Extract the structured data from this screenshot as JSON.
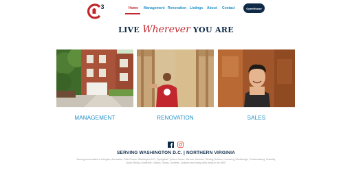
{
  "header": {
    "logo_alt": "C3",
    "nav": [
      {
        "label": "Home",
        "active": true
      },
      {
        "label": "Management",
        "active": false
      },
      {
        "label": "Renovation",
        "active": false
      },
      {
        "label": "Listings",
        "active": false
      },
      {
        "label": "About",
        "active": false
      },
      {
        "label": "Contact",
        "active": false
      }
    ],
    "cta_label": "OpenHouse"
  },
  "tagline": {
    "before": "LIVE",
    "script": "Wherever",
    "after": "YOU ARE"
  },
  "services": [
    {
      "label": "MANAGEMENT",
      "image": "brick-townhouse"
    },
    {
      "label": "RENOVATION",
      "image": "worker-in-attic"
    },
    {
      "label": "SALES",
      "image": "smiling-agent"
    }
  ],
  "social": {
    "icons": [
      "facebook-icon",
      "instagram-icon"
    ]
  },
  "footer": {
    "serving_title": "SERVING WASHINGTON D.C. | NORTHERN VIRGINIA",
    "communities": "Serving communities in Arlington, Alexandria, Falls Church, Washington D.C., Springfield, Tysons Corner, McLean, Herndon, Sterling, Ashburn, Leesburg, Woodbridge, Fredericksburg, Chantilly, South Riding, Centreville, Oakton, Fairfax, Dumfries, Quantico and many other areas in the DMV."
  },
  "colors": {
    "brand_red": "#c1272d",
    "brand_blue": "#1b8ec7",
    "navy": "#0e2a47"
  }
}
